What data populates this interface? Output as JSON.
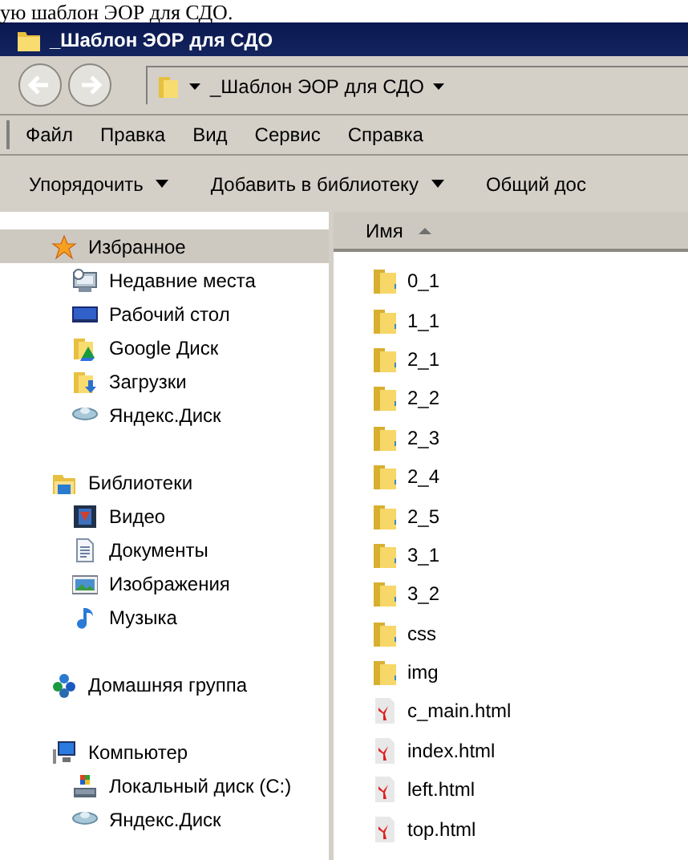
{
  "document_text": "ую шаблон ЭОР для СДО.",
  "window": {
    "title": "_Шаблон ЭОР для СДО"
  },
  "address": {
    "path": "_Шаблон ЭОР для СДО"
  },
  "menu": [
    "Файл",
    "Правка",
    "Вид",
    "Сервис",
    "Справка"
  ],
  "toolbar": [
    {
      "label": "Упорядочить",
      "dropdown": true
    },
    {
      "label": "Добавить в библиотеку",
      "dropdown": true
    },
    {
      "label": "Общий дос",
      "dropdown": false
    }
  ],
  "nav": [
    {
      "label": "Избранное",
      "selected": true,
      "children": [
        {
          "label": "Недавние места",
          "selected": false
        },
        {
          "label": "Рабочий стол",
          "selected": false
        },
        {
          "label": "Google Диск",
          "selected": false
        },
        {
          "label": "Загрузки",
          "selected": false
        },
        {
          "label": "Яндекс.Диск",
          "selected": false
        }
      ]
    },
    {
      "label": "Библиотеки",
      "selected": false,
      "children": [
        {
          "label": "Видео",
          "selected": false
        },
        {
          "label": "Документы",
          "selected": false
        },
        {
          "label": "Изображения",
          "selected": false
        },
        {
          "label": "Музыка",
          "selected": false
        }
      ]
    },
    {
      "label": "Домашняя группа",
      "selected": false
    },
    {
      "label": "Компьютер",
      "selected": false,
      "children": [
        {
          "label": "Локальный диск (C:)",
          "selected": false
        },
        {
          "label": "Яндекс.Диск",
          "selected": false
        }
      ]
    }
  ],
  "columns": [
    {
      "label": "Имя"
    }
  ],
  "files": [
    {
      "name": "0_1",
      "kind": "folder"
    },
    {
      "name": "1_1",
      "kind": "folder"
    },
    {
      "name": "2_1",
      "kind": "folder"
    },
    {
      "name": "2_2",
      "kind": "folder"
    },
    {
      "name": "2_3",
      "kind": "folder"
    },
    {
      "name": "2_4",
      "kind": "folder"
    },
    {
      "name": "2_5",
      "kind": "folder"
    },
    {
      "name": "3_1",
      "kind": "folder"
    },
    {
      "name": "3_2",
      "kind": "folder"
    },
    {
      "name": "css",
      "kind": "folder"
    },
    {
      "name": "img",
      "kind": "folder"
    },
    {
      "name": "c_main.html",
      "kind": "html"
    },
    {
      "name": "index.html",
      "kind": "html"
    },
    {
      "name": "left.html",
      "kind": "html"
    },
    {
      "name": "top.html",
      "kind": "html"
    }
  ]
}
